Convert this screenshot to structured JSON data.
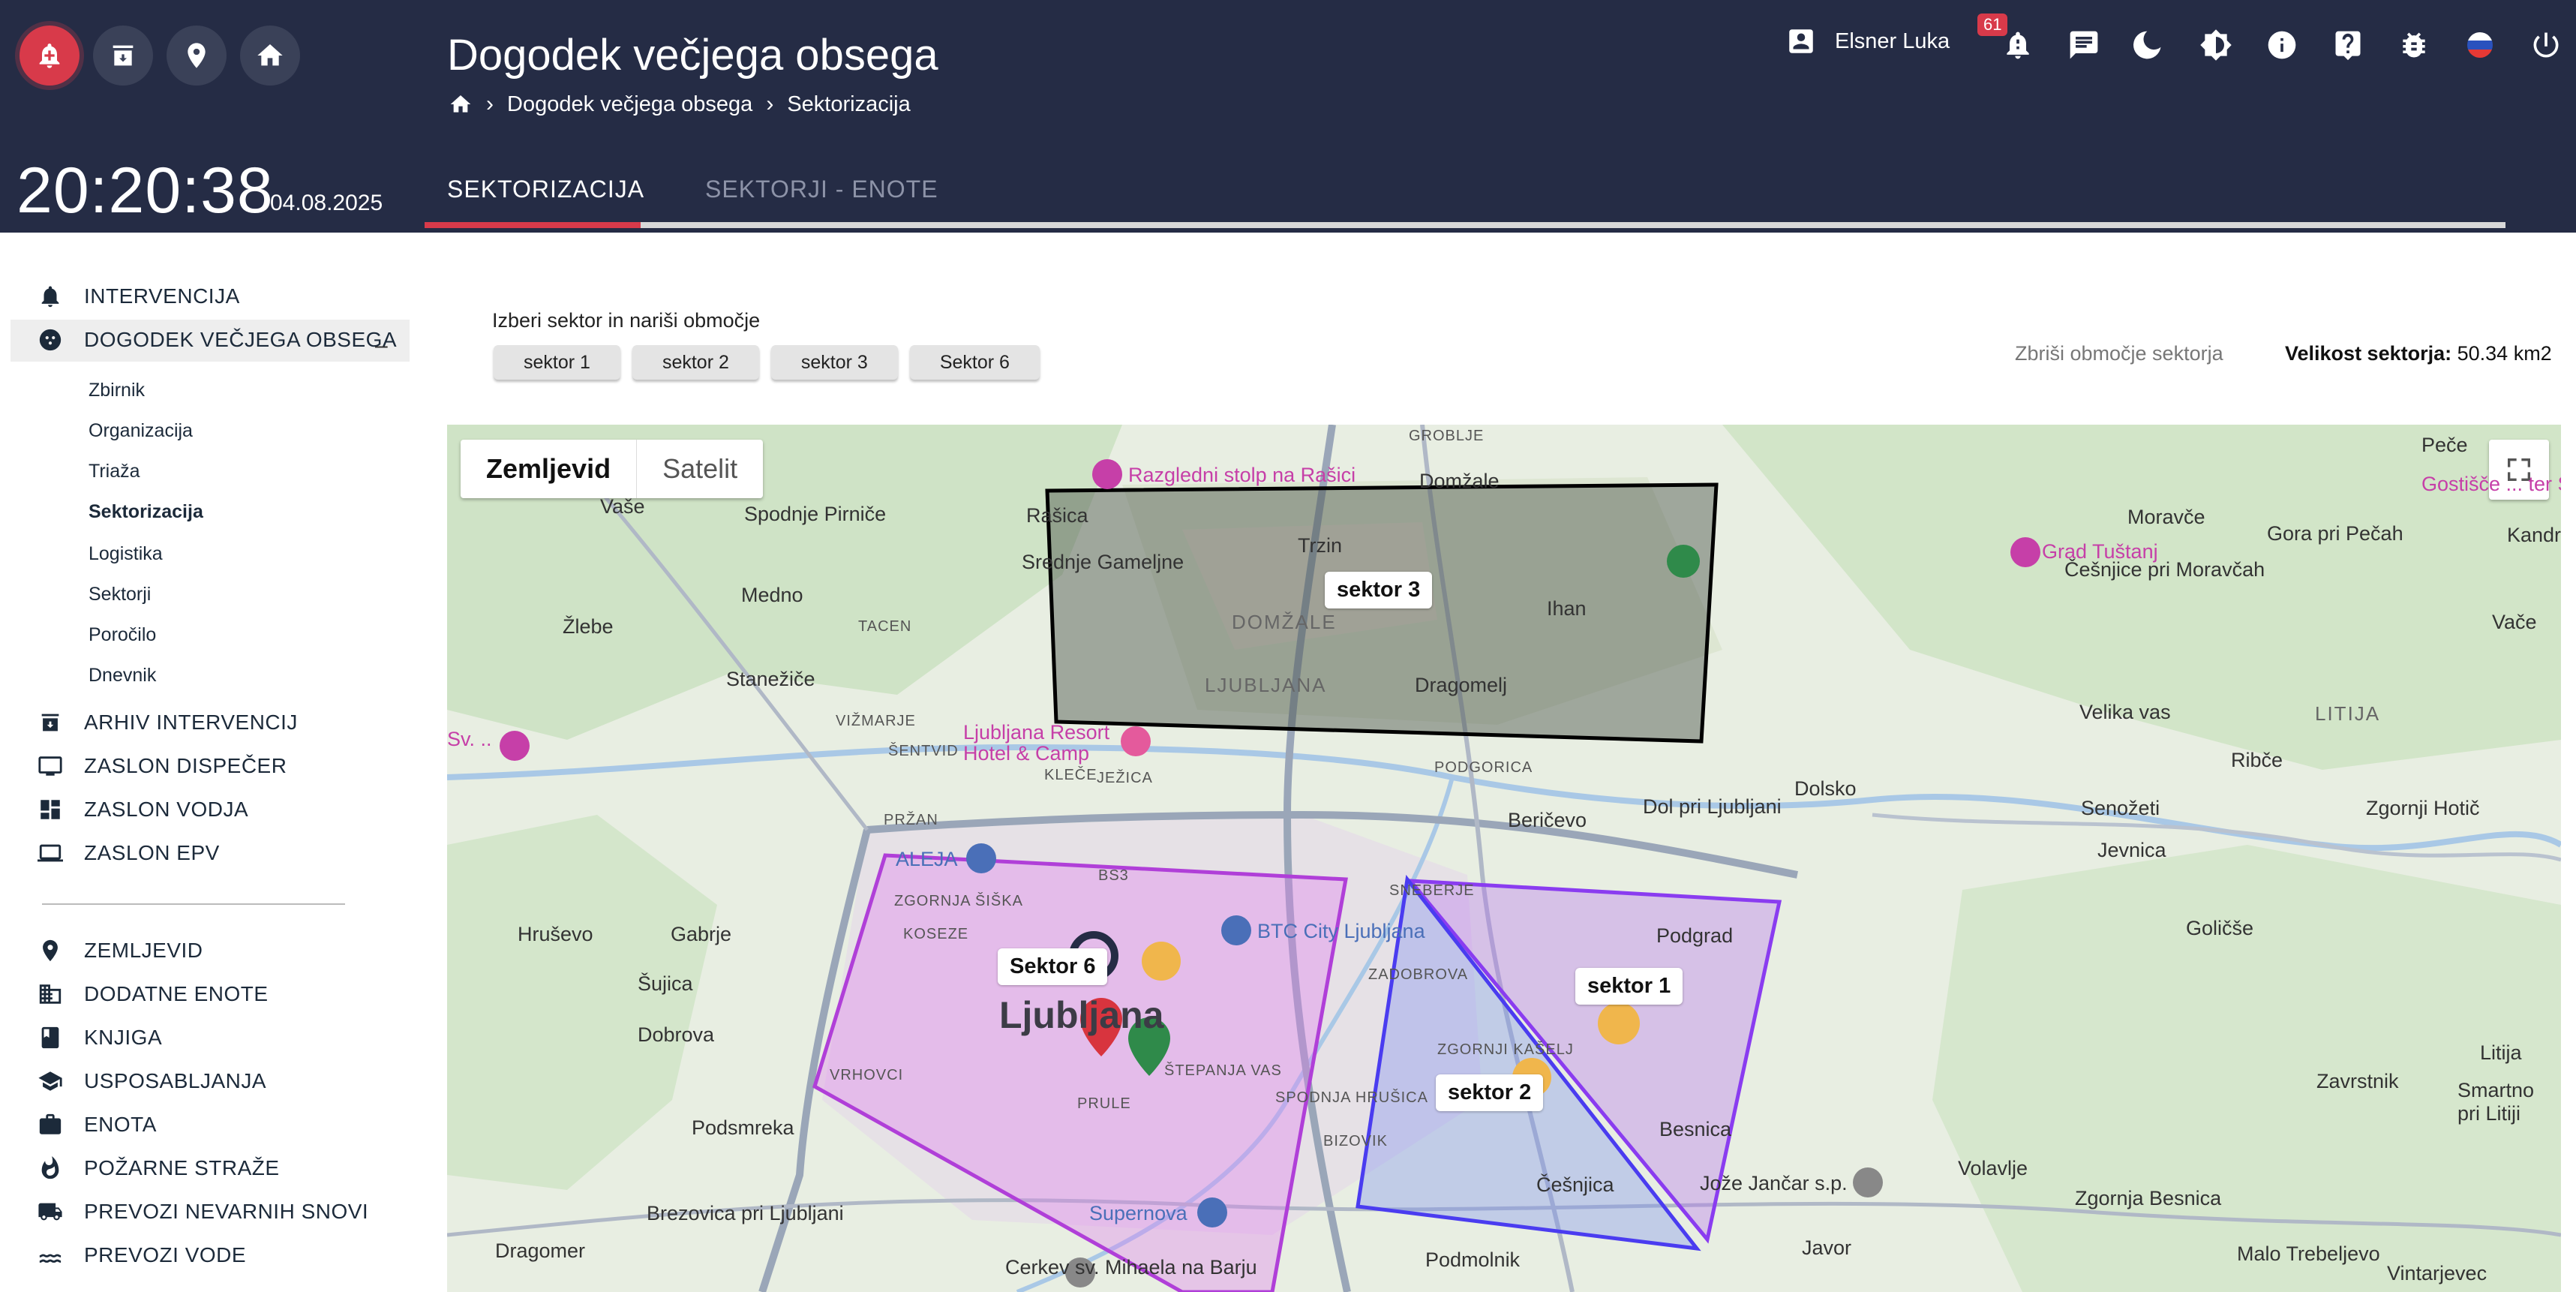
{
  "header": {
    "icon_buttons": [
      "alarm-icon",
      "archive-icon",
      "location-pin-icon",
      "home-icon"
    ],
    "clock": "20:20:38",
    "date": "04.08.2025",
    "title": "Dogodek večjega obsega",
    "breadcrumb": [
      "Dogodek večjega obsega",
      "Sektorizacija"
    ],
    "user_name": "Elsner Luka",
    "notification_count": "61",
    "top_icons": [
      "notification-icon",
      "chat-icon",
      "dark-mode-icon",
      "brightness-icon",
      "info-icon",
      "help-icon",
      "bug-icon",
      "slovenia-flag-icon",
      "power-icon"
    ]
  },
  "tabs": [
    {
      "label": "SEKTORIZACIJA",
      "active": true
    },
    {
      "label": "SEKTORJI - ENOTE",
      "active": false
    }
  ],
  "sidebar": {
    "items": [
      {
        "label": "INTERVENCIJA",
        "icon": "alarm-icon"
      },
      {
        "label": "DOGODEK VEČJEGA OBSEGA",
        "icon": "biohazard-icon",
        "expanded": true
      }
    ],
    "subitems": [
      {
        "label": "Zbirnik"
      },
      {
        "label": "Organizacija"
      },
      {
        "label": "Triaža"
      },
      {
        "label": "Sektorizacija",
        "active": true
      },
      {
        "label": "Logistika"
      },
      {
        "label": "Sektorji"
      },
      {
        "label": "Poročilo"
      },
      {
        "label": "Dnevnik"
      }
    ],
    "items2": [
      {
        "label": "ARHIV INTERVENCIJ",
        "icon": "archive-icon"
      },
      {
        "label": "ZASLON DISPEČER",
        "icon": "monitor-icon"
      },
      {
        "label": "ZASLON VODJA",
        "icon": "dashboard-icon"
      },
      {
        "label": "ZASLON EPV",
        "icon": "laptop-icon"
      }
    ],
    "items3": [
      {
        "label": "ZEMLJEVID",
        "icon": "location-pin-icon"
      },
      {
        "label": "DODATNE ENOTE",
        "icon": "building-icon"
      },
      {
        "label": "KNJIGA",
        "icon": "book-icon"
      },
      {
        "label": "USPOSABLJANJA",
        "icon": "school-icon"
      },
      {
        "label": "ENOTA",
        "icon": "unit-icon"
      },
      {
        "label": "POŽARNE STRAŽE",
        "icon": "fire-icon"
      },
      {
        "label": "PREVOZI NEVARNIH SNOVI",
        "icon": "truck-icon"
      },
      {
        "label": "PREVOZI VODE",
        "icon": "water-icon"
      }
    ],
    "collapse_symbol": "–"
  },
  "main": {
    "select_label": "Izberi sektor in nariši območje",
    "sector_buttons": [
      "sektor 1",
      "sektor 2",
      "sektor 3",
      "Sektor 6"
    ],
    "delete_area": "Zbriši območje sektorja",
    "size_label": "Velikost sektorja:",
    "size_value": "50.34 km2"
  },
  "map": {
    "toggle": [
      "Zemljevid",
      "Satelit"
    ],
    "sector_labels": [
      "sektor 3",
      "Sektor 6",
      "sektor 1",
      "sektor 2"
    ],
    "colors": {
      "sector3": "#000000",
      "sector6": "#b03fd8",
      "sector1": "#8a3cf0",
      "sector2": "#4a3cf0"
    },
    "places": [
      "Vaše",
      "Spodnje Pirniče",
      "Rašica",
      "Srednje Gameljne",
      "Trzin",
      "DOMŽALE",
      "Ihan",
      "Dragomelj",
      "LJUBLJANA",
      "Medno",
      "Žlebe",
      "Stanežiče",
      "TACEN",
      "VIŽMARJE",
      "ŠENTVID",
      "KLEČE",
      "JEŽICA",
      "PODGORICA",
      "Beričevo",
      "Dol pri Ljubljani",
      "Dolsko",
      "Senožeti",
      "Zgornji Hotič",
      "Jevnica",
      "Ribče",
      "Velika vas",
      "LITIJA",
      "Moravče",
      "Gora pri Pečah",
      "Češnjice pri Moravčah",
      "Peče",
      "Domžale",
      "GROBLJE",
      "Vače",
      "Kandrš",
      "PRŽAN",
      "ZGORNJA ŠIŠKA",
      "KOSEZE",
      "Hruševo",
      "Gabrje",
      "Šujica",
      "Dobrova",
      "Ljubljana",
      "VRHOVCI",
      "PRULE",
      "ŠTEPANJA VAS",
      "SPODNJA HRUŠICA",
      "BIZOVIK",
      "ZADOBROVA",
      "ZGORNJI KAŠELJ",
      "SNEBERJE",
      "Podgrad",
      "Besnica",
      "Češnjica",
      "Podsmreka",
      "Brezovica pri Ljubljani",
      "Dragomer",
      "Podmolnik",
      "Javor",
      "Volavlje",
      "Zgornja Besnica",
      "Malo Trebeljevo",
      "Vintarjevec",
      "Litija",
      "Zavrstnik",
      "Smartno pri Litiji",
      "Goličše",
      "Cerkev sv. Mihaela na Barju",
      "BS3"
    ],
    "pois": [
      "Razgledni stolp na Rašici",
      "Grad Tuštanj",
      "Ljubljana Resort Hotel & Camp",
      "ALEJA",
      "BTC City Ljubljana",
      "Supernova",
      "Jože Jančar s.p.",
      "Gostišče ... ter SRD",
      "Sv. ... opol"
    ]
  }
}
